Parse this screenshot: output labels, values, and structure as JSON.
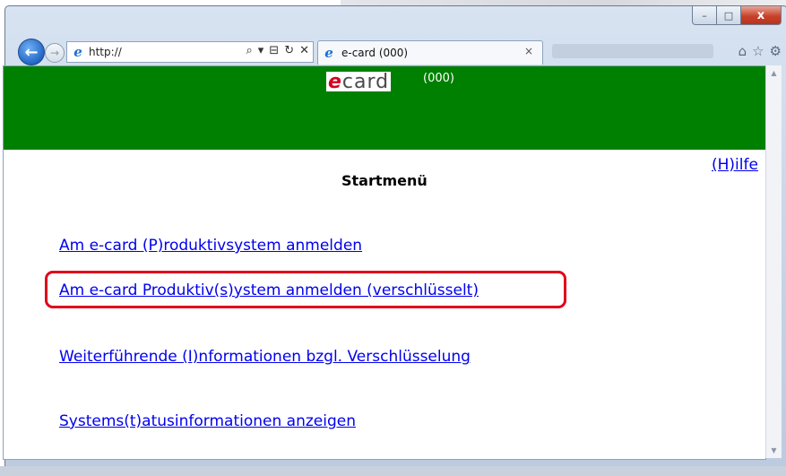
{
  "window": {
    "minimize": "–",
    "maximize": "□",
    "close": "x"
  },
  "navbar": {
    "back_glyph": "←",
    "forward_glyph": "→",
    "address_icon": "e",
    "address": "http://",
    "search_icon": "⌕",
    "dropdown_glyph": "▾",
    "compat_glyph": "⊟",
    "refresh_glyph": "↻",
    "stop_glyph": "✕",
    "tab": {
      "icon": "e",
      "title": "e-card (000)",
      "close": "×"
    },
    "home_glyph": "⌂",
    "favorites_glyph": "☆",
    "tools_glyph": "⚙"
  },
  "page": {
    "logo_e": "e",
    "logo_rest": "card",
    "logo_suffix": "(000)",
    "help_link": "(H)ilfe",
    "heading": "Startmenü",
    "links": [
      "Am e-card (P)roduktivsystem anmelden",
      "Am e-card Produktiv(s)ystem anmelden (verschlüsselt)",
      "Weiterführende (I)nformationen bzgl. Verschlüsselung",
      "Systems(t)atusinformationen anzeigen"
    ]
  },
  "colors": {
    "header_green": "#008000",
    "link_blue": "#0000ee",
    "highlight_red": "#e0001b"
  }
}
